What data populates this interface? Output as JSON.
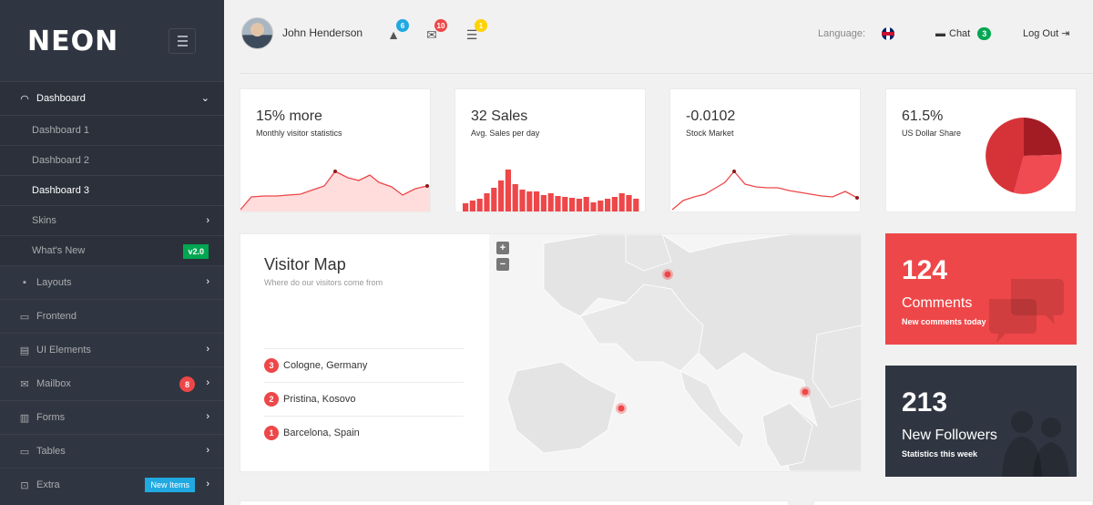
{
  "app": {
    "logo": "NEON"
  },
  "sidebar": {
    "items": [
      {
        "label": "Dashboard",
        "icon": "gauge-icon"
      },
      {
        "label": "Dashboard 1"
      },
      {
        "label": "Dashboard 2"
      },
      {
        "label": "Dashboard 3"
      },
      {
        "label": "Skins"
      },
      {
        "label": "What's New",
        "badge": "v2.0"
      },
      {
        "label": "Layouts",
        "icon": "grid-icon"
      },
      {
        "label": "Frontend",
        "icon": "monitor-icon"
      },
      {
        "label": "UI Elements",
        "icon": "notebook-icon"
      },
      {
        "label": "Mailbox",
        "icon": "envelope-icon",
        "badge": "8"
      },
      {
        "label": "Forms",
        "icon": "document-icon"
      },
      {
        "label": "Tables",
        "icon": "window-icon"
      },
      {
        "label": "Extra",
        "icon": "bag-icon",
        "badge": "New Items"
      }
    ]
  },
  "topbar": {
    "user_name": "John Henderson",
    "alerts_count": "6",
    "messages_count": "10",
    "tasks_count": "1",
    "language_label": "Language:",
    "chat_label": "Chat",
    "chat_count": "3",
    "logout_label": "Log Out"
  },
  "tiles": [
    {
      "value": "15% more",
      "label": "Monthly visitor statistics"
    },
    {
      "value": "32 Sales",
      "label": "Avg. Sales per day"
    },
    {
      "value": "-0.0102",
      "label": "Stock Market"
    },
    {
      "value": "61.5%",
      "label": "US Dollar Share"
    }
  ],
  "map": {
    "title": "Visitor Map",
    "subtitle": "Where do our visitors come from",
    "zoom_in": "+",
    "zoom_out": "−",
    "cities": [
      {
        "count": "3",
        "name": "Cologne, Germany"
      },
      {
        "count": "2",
        "name": "Pristina, Kosovo"
      },
      {
        "count": "1",
        "name": "Barcelona, Spain"
      }
    ]
  },
  "stats": [
    {
      "value": "124",
      "title": "Comments",
      "caption": "New comments today"
    },
    {
      "value": "213",
      "title": "New Followers",
      "caption": "Statistics this week"
    }
  ],
  "colors": {
    "red": "#ee4749",
    "dark": "#303641",
    "green": "#00a651",
    "blue": "#21a9e1",
    "yellow": "#ffd200"
  }
}
